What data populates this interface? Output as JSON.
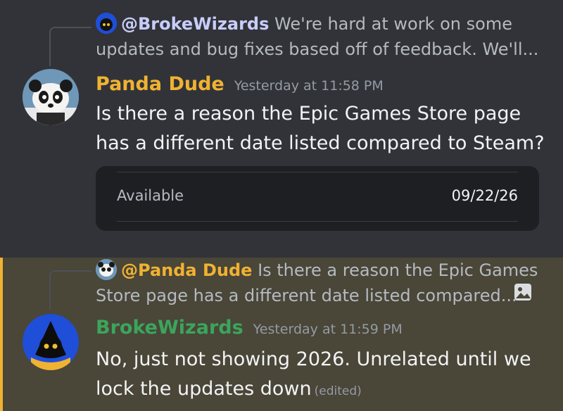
{
  "message1": {
    "reply": {
      "mention": "@BrokeWizards",
      "preview_line1": "We're hard at work on some",
      "preview_line2": "updates and bug fixes based off of feedback. We'll..."
    },
    "author": "Panda Dude",
    "author_color": "#f0b232",
    "timestamp": "Yesterday at 11:58 PM",
    "content_line1": "Is there a reason the Epic Games Store page",
    "content_line2": "has a different date listed compared to Steam?",
    "embed": {
      "label": "Available",
      "value": "09/22/26"
    }
  },
  "message2": {
    "reply": {
      "mention": "@Panda Dude",
      "preview_line1": "Is there a reason the Epic Games",
      "preview_line2": "Store page has a different date listed compared...",
      "attachment_icon": "image-icon"
    },
    "author": "BrokeWizards",
    "author_color": "#3ba55c",
    "timestamp": "Yesterday at 11:59 PM",
    "content_line1": "No, just not showing 2026. Unrelated until we",
    "content_line2": "lock the updates down",
    "edited": "(edited)",
    "highlight_color": "#f0b232"
  }
}
